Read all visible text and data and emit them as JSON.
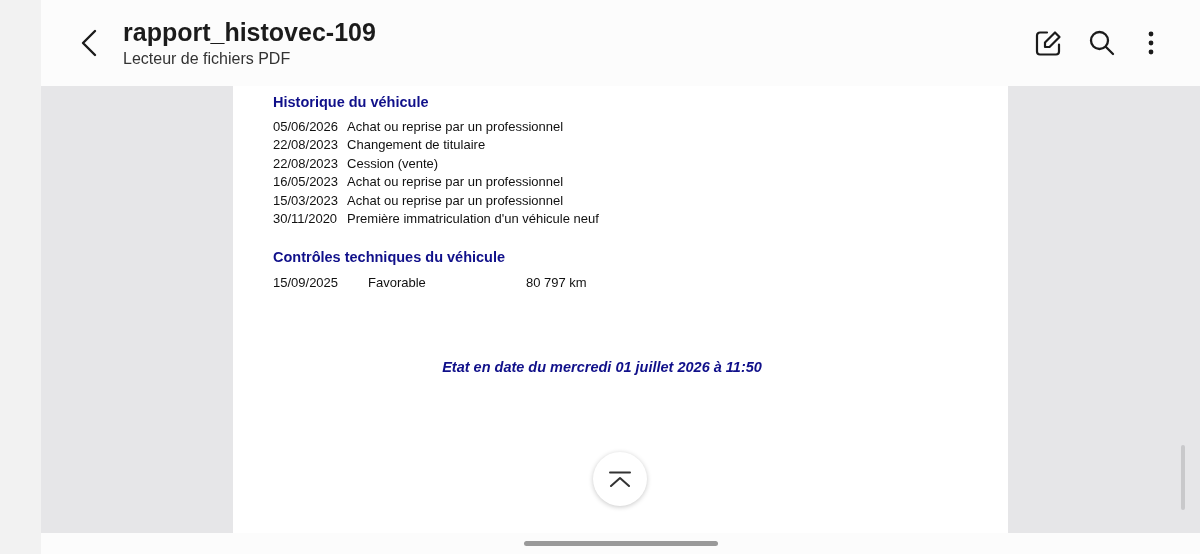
{
  "header": {
    "title": "rapport_histovec-109",
    "subtitle": "Lecteur de fichiers PDF"
  },
  "document": {
    "history": {
      "heading": "Historique du véhicule",
      "rows": [
        {
          "date": "05/06/2026",
          "event": "Achat ou reprise par un professionnel"
        },
        {
          "date": "22/08/2023",
          "event": "Changement de titulaire"
        },
        {
          "date": "22/08/2023",
          "event": "Cession (vente)"
        },
        {
          "date": "16/05/2023",
          "event": "Achat ou reprise par un professionnel"
        },
        {
          "date": "15/03/2023",
          "event": "Achat ou reprise par un professionnel"
        },
        {
          "date": "30/11/2020",
          "event": "Première immatriculation d'un véhicule neuf"
        }
      ]
    },
    "inspections": {
      "heading": "Contrôles techniques du véhicule",
      "rows": [
        {
          "date": "15/09/2025",
          "result": "Favorable",
          "mileage": "80 797 km"
        }
      ]
    },
    "footer": "Etat en date du mercredi 01 juillet 2026 à 11:50"
  }
}
